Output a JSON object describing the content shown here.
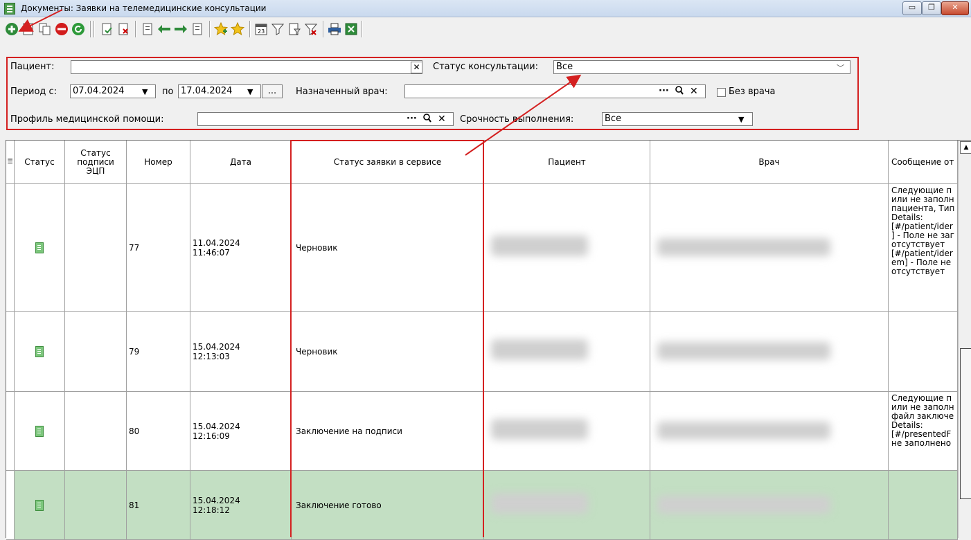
{
  "window": {
    "title": "Документы: Заявки на телемедицинские консультации",
    "minimize_glyph": "▭",
    "restore_glyph": "❐",
    "close_glyph": "✕"
  },
  "toolbar_icons": [
    "add-icon",
    "edit-icon",
    "copy-icon",
    "delete-icon",
    "refresh-icon",
    "approve-icon",
    "disapprove-icon",
    "move-in-icon",
    "arrow-left-icon",
    "arrow-right-icon",
    "move-out-icon",
    "star-add-icon",
    "star-icon",
    "calendar-icon",
    "filter-icon",
    "filter-apply-icon",
    "filter-clear-icon",
    "print-icon",
    "excel-icon"
  ],
  "filters": {
    "patient_label": "Пациент:",
    "patient_value": "",
    "status_label": "Статус консультации:",
    "status_value": "Все",
    "period_label": "Период с:",
    "period_from": "07.04.2024",
    "period_to_label": "по",
    "period_to": "17.04.2024",
    "period_more": "...",
    "doctor_label": "Назначенный врач:",
    "doctor_value": "",
    "no_doctor_label": "Без врача",
    "profile_label": "Профиль медицинской помощи:",
    "profile_value": "",
    "urgency_label": "Срочность выполнения:",
    "urgency_value": "Все",
    "clear_glyph": "✕",
    "dots_glyph": "···",
    "search_glyph": "🔍"
  },
  "grid": {
    "columns": [
      "Статус",
      "Статус подписи ЭЦП",
      "Номер",
      "Дата",
      "Статус заявки в сервисе",
      "Пациент",
      "Врач",
      "Сообщение от"
    ],
    "rows": [
      {
        "number": "77",
        "date": "11.04.2024",
        "time": "11:46:07",
        "service_status": "Черновик",
        "message": "Следующие п\nили не заполн\nпациента, Тип\nDetails:\n[#/patient/ider\n] - Поле не заг\nотсутствует\n[#/patient/ider\nem] - Поле не\nотсутствует"
      },
      {
        "number": "79",
        "date": "15.04.2024",
        "time": "12:13:03",
        "service_status": "Черновик",
        "message": ""
      },
      {
        "number": "80",
        "date": "15.04.2024",
        "time": "12:16:09",
        "service_status": "Заключение на подписи",
        "message": "Следующие п\nили не заполн\nфайл заключе\nDetails:\n[#/presentedF\nне заполнено"
      },
      {
        "number": "81",
        "date": "15.04.2024",
        "time": "12:18:12",
        "service_status": "Заключение готово",
        "message": ""
      }
    ],
    "highlight_color": "#c3dfc3"
  }
}
